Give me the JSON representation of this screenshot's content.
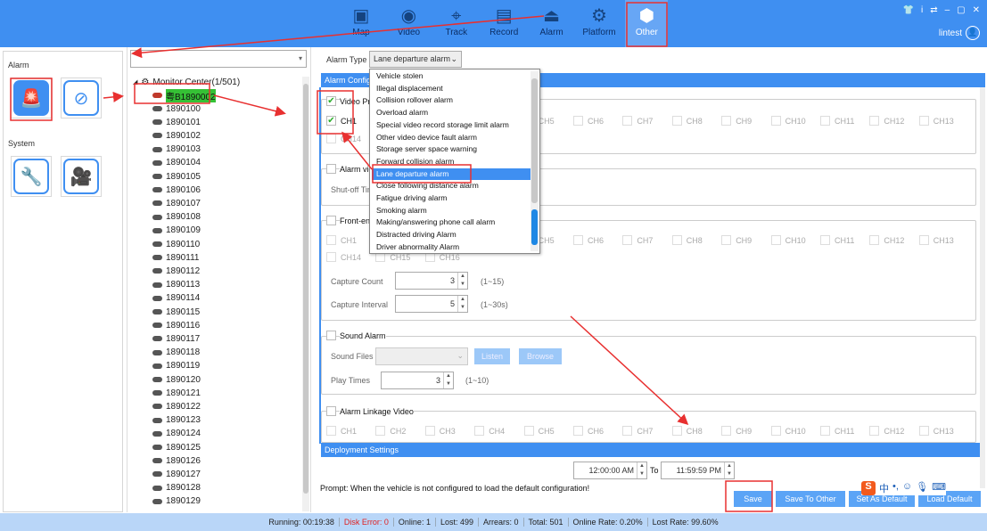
{
  "header": {
    "nav": [
      {
        "label": "Map",
        "icon": "map-monitor-icon"
      },
      {
        "label": "Video",
        "icon": "camera-icon"
      },
      {
        "label": "Track",
        "icon": "track-pin-icon"
      },
      {
        "label": "Record",
        "icon": "film-icon"
      },
      {
        "label": "Alarm",
        "icon": "alarm-light-icon"
      },
      {
        "label": "Platform",
        "icon": "gear-icon"
      },
      {
        "label": "Other",
        "icon": "cube-icon",
        "active": true
      }
    ],
    "window_buttons": [
      "skin-icon",
      "info-icon",
      "switch-icon",
      "minimize-icon",
      "maximize-icon",
      "close-icon"
    ],
    "username": "lintest"
  },
  "left_panel": {
    "alarm_label": "Alarm",
    "system_label": "System"
  },
  "tree": {
    "search_placeholder": "",
    "root": "Monitor Center(1/501)",
    "selected": "粤B1890002",
    "items": [
      "1890100",
      "1890101",
      "1890102",
      "1890103",
      "1890104",
      "1890105",
      "1890106",
      "1890107",
      "1890108",
      "1890109",
      "1890110",
      "1890111",
      "1890112",
      "1890113",
      "1890114",
      "1890115",
      "1890116",
      "1890117",
      "1890118",
      "1890119",
      "1890120",
      "1890121",
      "1890122",
      "1890123",
      "1890124",
      "1890125",
      "1890126",
      "1890127",
      "1890128",
      "1890129"
    ]
  },
  "main": {
    "alarm_type_label": "Alarm Type",
    "alarm_type_value": "Lane departure alarm",
    "alarm_config_title": "Alarm Config",
    "video_section": {
      "title": "Video Pr",
      "checked": true,
      "ch1_checked": true
    },
    "alarm_video_section": {
      "title": "Alarm vid",
      "shutoff_label": "Shut-off Tim"
    },
    "front_end_section": {
      "title": "Front-end",
      "capture_count_label": "Capture Count",
      "capture_count": "3",
      "capture_count_range": "(1~15)",
      "capture_interval_label": "Capture Interval",
      "capture_interval": "5",
      "capture_interval_range": "(1~30s)"
    },
    "sound_section": {
      "title": "Sound Alarm",
      "files_label": "Sound Files",
      "listen": "Listen",
      "browse": "Browse",
      "play_times_label": "Play Times",
      "play_times": "3",
      "play_times_range": "(1~10)"
    },
    "linkage_section": {
      "title": "Alarm Linkage Video"
    },
    "channels_row1": [
      "CH1",
      "CH2",
      "CH3",
      "CH4",
      "CH5",
      "CH6",
      "CH7",
      "CH8",
      "CH9",
      "CH10",
      "CH11",
      "CH12",
      "CH13"
    ],
    "channels_row2": [
      "CH14",
      "CH15",
      "CH16"
    ],
    "deployment_title": "Deployment Settings",
    "time_from": "12:00:00 AM",
    "time_to_label": "To",
    "time_to": "11:59:59 PM",
    "prompt": "Prompt:  When the vehicle is not configured to load the default configuration!",
    "buttons": {
      "save": "Save",
      "save_to_other": "Save To Other",
      "set_default": "Set As Default",
      "load_default": "Load Default"
    }
  },
  "dropdown": {
    "options": [
      "Vehicle stolen",
      "Illegal displacement",
      "Collision rollover alarm",
      "Overload alarm",
      "Special video record storage limit alarm",
      "Other video device fault alarm",
      "Storage server space warning",
      "Forward collision alarm",
      "Lane departure alarm",
      "Close following distance alarm",
      "Fatigue driving alarm",
      "Smoking alarm",
      "Making/answering phone call alarm",
      "Distracted driving Alarm",
      "Driver abnormality Alarm"
    ],
    "selected_index": 8
  },
  "status": {
    "running": "Running:  00:19:38",
    "disk_error": "Disk Error:  0",
    "online": "Online:  1",
    "lost": "Lost:  499",
    "arrears": "Arrears:  0",
    "total": "Total:  501",
    "online_rate": "Online Rate:  0.20%",
    "lost_rate": "Lost Rate:  99.60%"
  },
  "colors": {
    "accent": "#3f8ff1",
    "annotation": "#e83030",
    "highlight": "#35c135"
  }
}
